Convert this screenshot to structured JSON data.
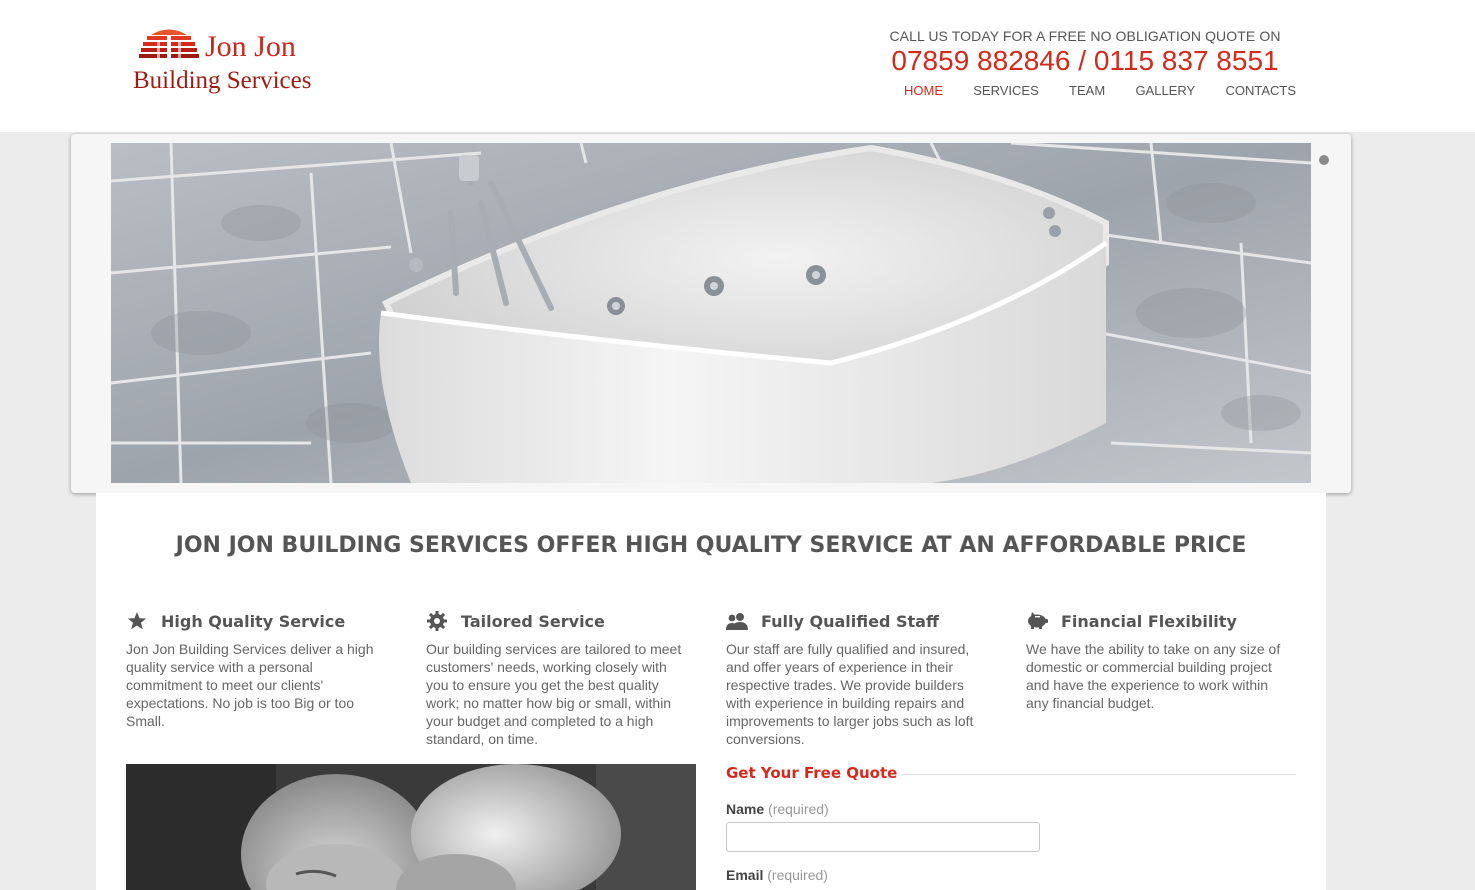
{
  "logo": {
    "line1": "Jon Jon",
    "line2": "Building Services"
  },
  "header": {
    "call_text": "CALL US TODAY FOR A FREE NO OBLIGATION QUOTE ON",
    "phones": "07859 882846 / 0115 837 8551"
  },
  "nav": {
    "items": [
      {
        "label": "HOME",
        "active": true
      },
      {
        "label": "SERVICES",
        "active": false
      },
      {
        "label": "TEAM",
        "active": false
      },
      {
        "label": "GALLERY",
        "active": false
      },
      {
        "label": "CONTACTS",
        "active": false
      }
    ]
  },
  "main": {
    "headline": "JON JON BUILDING SERVICES OFFER HIGH QUALITY SERVICE AT AN AFFORDABLE PRICE",
    "features": [
      {
        "icon": "star-icon",
        "title": "High Quality Service",
        "text": "Jon Jon Building Services deliver a high quality service with a personal commitment to meet our clients' expectations. No job is too Big or too Small."
      },
      {
        "icon": "gear-icon",
        "title": "Tailored Service",
        "text": "Our building services are tailored to meet customers' needs, working closely with you to ensure you get the best quality work; no matter how big or small, within your budget and completed to a high standard, on time."
      },
      {
        "icon": "users-icon",
        "title": "Fully Qualified Staff",
        "text": "Our staff are fully qualified and insured, and offer years of experience in their respective trades. We provide builders with experience in building repairs and improvements to larger jobs such as loft conversions."
      },
      {
        "icon": "piggy-bank-icon",
        "title": "Financial Flexibility",
        "text": "We have the ability to take on any size of domestic or commercial building project and have the experience to work within any financial budget."
      }
    ]
  },
  "quote_form": {
    "title": "Get Your Free Quote",
    "name_label": "Name",
    "name_required": "(required)",
    "name_value": "",
    "email_label": "Email",
    "email_required": "(required)"
  },
  "colors": {
    "accent": "#d42a1e",
    "text": "#555555",
    "page_bg": "#ececec"
  }
}
